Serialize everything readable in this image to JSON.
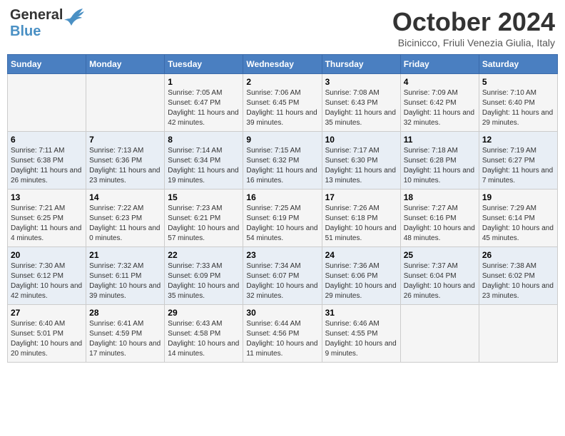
{
  "header": {
    "logo_line1": "General",
    "logo_line2": "Blue",
    "main_title": "October 2024",
    "subtitle": "Bicinicco, Friuli Venezia Giulia, Italy"
  },
  "days_of_week": [
    "Sunday",
    "Monday",
    "Tuesday",
    "Wednesday",
    "Thursday",
    "Friday",
    "Saturday"
  ],
  "weeks": [
    [
      {
        "day": "",
        "info": ""
      },
      {
        "day": "",
        "info": ""
      },
      {
        "day": "1",
        "info": "Sunrise: 7:05 AM\nSunset: 6:47 PM\nDaylight: 11 hours and 42 minutes."
      },
      {
        "day": "2",
        "info": "Sunrise: 7:06 AM\nSunset: 6:45 PM\nDaylight: 11 hours and 39 minutes."
      },
      {
        "day": "3",
        "info": "Sunrise: 7:08 AM\nSunset: 6:43 PM\nDaylight: 11 hours and 35 minutes."
      },
      {
        "day": "4",
        "info": "Sunrise: 7:09 AM\nSunset: 6:42 PM\nDaylight: 11 hours and 32 minutes."
      },
      {
        "day": "5",
        "info": "Sunrise: 7:10 AM\nSunset: 6:40 PM\nDaylight: 11 hours and 29 minutes."
      }
    ],
    [
      {
        "day": "6",
        "info": "Sunrise: 7:11 AM\nSunset: 6:38 PM\nDaylight: 11 hours and 26 minutes."
      },
      {
        "day": "7",
        "info": "Sunrise: 7:13 AM\nSunset: 6:36 PM\nDaylight: 11 hours and 23 minutes."
      },
      {
        "day": "8",
        "info": "Sunrise: 7:14 AM\nSunset: 6:34 PM\nDaylight: 11 hours and 19 minutes."
      },
      {
        "day": "9",
        "info": "Sunrise: 7:15 AM\nSunset: 6:32 PM\nDaylight: 11 hours and 16 minutes."
      },
      {
        "day": "10",
        "info": "Sunrise: 7:17 AM\nSunset: 6:30 PM\nDaylight: 11 hours and 13 minutes."
      },
      {
        "day": "11",
        "info": "Sunrise: 7:18 AM\nSunset: 6:28 PM\nDaylight: 11 hours and 10 minutes."
      },
      {
        "day": "12",
        "info": "Sunrise: 7:19 AM\nSunset: 6:27 PM\nDaylight: 11 hours and 7 minutes."
      }
    ],
    [
      {
        "day": "13",
        "info": "Sunrise: 7:21 AM\nSunset: 6:25 PM\nDaylight: 11 hours and 4 minutes."
      },
      {
        "day": "14",
        "info": "Sunrise: 7:22 AM\nSunset: 6:23 PM\nDaylight: 11 hours and 0 minutes."
      },
      {
        "day": "15",
        "info": "Sunrise: 7:23 AM\nSunset: 6:21 PM\nDaylight: 10 hours and 57 minutes."
      },
      {
        "day": "16",
        "info": "Sunrise: 7:25 AM\nSunset: 6:19 PM\nDaylight: 10 hours and 54 minutes."
      },
      {
        "day": "17",
        "info": "Sunrise: 7:26 AM\nSunset: 6:18 PM\nDaylight: 10 hours and 51 minutes."
      },
      {
        "day": "18",
        "info": "Sunrise: 7:27 AM\nSunset: 6:16 PM\nDaylight: 10 hours and 48 minutes."
      },
      {
        "day": "19",
        "info": "Sunrise: 7:29 AM\nSunset: 6:14 PM\nDaylight: 10 hours and 45 minutes."
      }
    ],
    [
      {
        "day": "20",
        "info": "Sunrise: 7:30 AM\nSunset: 6:12 PM\nDaylight: 10 hours and 42 minutes."
      },
      {
        "day": "21",
        "info": "Sunrise: 7:32 AM\nSunset: 6:11 PM\nDaylight: 10 hours and 39 minutes."
      },
      {
        "day": "22",
        "info": "Sunrise: 7:33 AM\nSunset: 6:09 PM\nDaylight: 10 hours and 35 minutes."
      },
      {
        "day": "23",
        "info": "Sunrise: 7:34 AM\nSunset: 6:07 PM\nDaylight: 10 hours and 32 minutes."
      },
      {
        "day": "24",
        "info": "Sunrise: 7:36 AM\nSunset: 6:06 PM\nDaylight: 10 hours and 29 minutes."
      },
      {
        "day": "25",
        "info": "Sunrise: 7:37 AM\nSunset: 6:04 PM\nDaylight: 10 hours and 26 minutes."
      },
      {
        "day": "26",
        "info": "Sunrise: 7:38 AM\nSunset: 6:02 PM\nDaylight: 10 hours and 23 minutes."
      }
    ],
    [
      {
        "day": "27",
        "info": "Sunrise: 6:40 AM\nSunset: 5:01 PM\nDaylight: 10 hours and 20 minutes."
      },
      {
        "day": "28",
        "info": "Sunrise: 6:41 AM\nSunset: 4:59 PM\nDaylight: 10 hours and 17 minutes."
      },
      {
        "day": "29",
        "info": "Sunrise: 6:43 AM\nSunset: 4:58 PM\nDaylight: 10 hours and 14 minutes."
      },
      {
        "day": "30",
        "info": "Sunrise: 6:44 AM\nSunset: 4:56 PM\nDaylight: 10 hours and 11 minutes."
      },
      {
        "day": "31",
        "info": "Sunrise: 6:46 AM\nSunset: 4:55 PM\nDaylight: 10 hours and 9 minutes."
      },
      {
        "day": "",
        "info": ""
      },
      {
        "day": "",
        "info": ""
      }
    ]
  ]
}
